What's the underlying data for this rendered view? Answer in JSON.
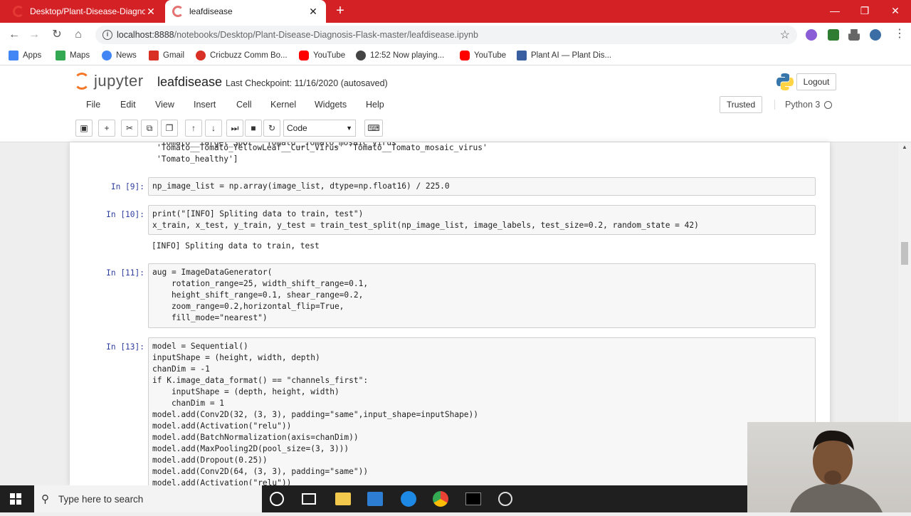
{
  "browser": {
    "tabs": [
      {
        "title": "Desktop/Plant-Disease-Diagnosi"
      },
      {
        "title": "leafdisease"
      }
    ],
    "url_host": "localhost:8888",
    "url_path": "/notebooks/Desktop/Plant-Disease-Diagnosis-Flask-master/leafdisease.ipynb",
    "bookmarks": [
      {
        "label": "Apps",
        "icon": "apps-icon",
        "color": "#4285f4"
      },
      {
        "label": "Maps",
        "icon": "maps-icon",
        "color": "#34a853"
      },
      {
        "label": "News",
        "icon": "news-icon",
        "color": "#4285f4"
      },
      {
        "label": "Gmail",
        "icon": "gmail-icon",
        "color": "#d93025"
      },
      {
        "label": "Cricbuzz Comm Bo...",
        "icon": "cricbuzz-icon",
        "color": "#d93025"
      },
      {
        "label": "YouTube",
        "icon": "youtube-icon",
        "color": "#ff0000"
      },
      {
        "label": "12:52 Now playing...",
        "icon": "globe-icon",
        "color": "#444444"
      },
      {
        "label": "YouTube",
        "icon": "youtube-icon",
        "color": "#ff0000"
      },
      {
        "label": "Plant AI — Plant Dis...",
        "icon": "plantai-icon",
        "color": "#3a5fa0"
      }
    ]
  },
  "jupyter": {
    "logo_text": "jupyter",
    "notebook_name": "leafdisease",
    "checkpoint": "Last Checkpoint: 11/16/2020  (autosaved)",
    "logout_label": "Logout",
    "menu": [
      "File",
      "Edit",
      "View",
      "Insert",
      "Cell",
      "Kernel",
      "Widgets",
      "Help"
    ],
    "trusted_label": "Trusted",
    "kernel_name": "Python 3",
    "cell_type": "Code",
    "toolbar_icons": [
      "save-icon",
      "add-cell-icon",
      "cut-icon",
      "copy-icon",
      "paste-icon",
      "move-up-icon",
      "move-down-icon",
      "run-icon",
      "stop-icon",
      "restart-icon"
    ],
    "command_palette_icon": "keyboard-icon"
  },
  "cells": {
    "prev_output": [
      "'Tomato__Tomato_YellowLeaf__Curl_Virus' 'Tomato__Tomato_mosaic_virus'",
      "'Tomato_healthy']"
    ],
    "c9": {
      "prompt": "In [9]:",
      "code": "np_image_list = np.array(image_list, dtype=np.float16) / 225.0"
    },
    "c10": {
      "prompt": "In [10]:",
      "line1": "print(\"[INFO] Spliting data to train, test\")",
      "line2": "x_train, x_test, y_train, y_test = train_test_split(np_image_list, image_labels, test_size=0.2, random_state = 42)",
      "output": "[INFO] Spliting data to train, test"
    },
    "c11": {
      "prompt": "In [11]:",
      "lines": [
        "aug = ImageDataGenerator(",
        "    rotation_range=25, width_shift_range=0.1,",
        "    height_shift_range=0.1, shear_range=0.2,",
        "    zoom_range=0.2,horizontal_flip=True,",
        "    fill_mode=\"nearest\")"
      ]
    },
    "c13": {
      "prompt": "In [13]:",
      "lines": [
        "model = Sequential()",
        "inputShape = (height, width, depth)",
        "chanDim = -1",
        "if K.image_data_format() == \"channels_first\":",
        "    inputShape = (depth, height, width)",
        "    chanDim = 1",
        "model.add(Conv2D(32, (3, 3), padding=\"same\",input_shape=inputShape))",
        "model.add(Activation(\"relu\"))",
        "model.add(BatchNormalization(axis=chanDim))",
        "model.add(MaxPooling2D(pool_size=(3, 3)))",
        "model.add(Dropout(0.25))",
        "model.add(Conv2D(64, (3, 3), padding=\"same\"))",
        "model.add(Activation(\"relu\"))"
      ]
    }
  },
  "taskbar": {
    "search_placeholder": "Type here to search",
    "apps": [
      "cortana-icon",
      "task-view-icon",
      "file-explorer-icon",
      "store-icon",
      "edge-icon",
      "chrome-icon",
      "terminal-icon",
      "obs-icon"
    ]
  }
}
